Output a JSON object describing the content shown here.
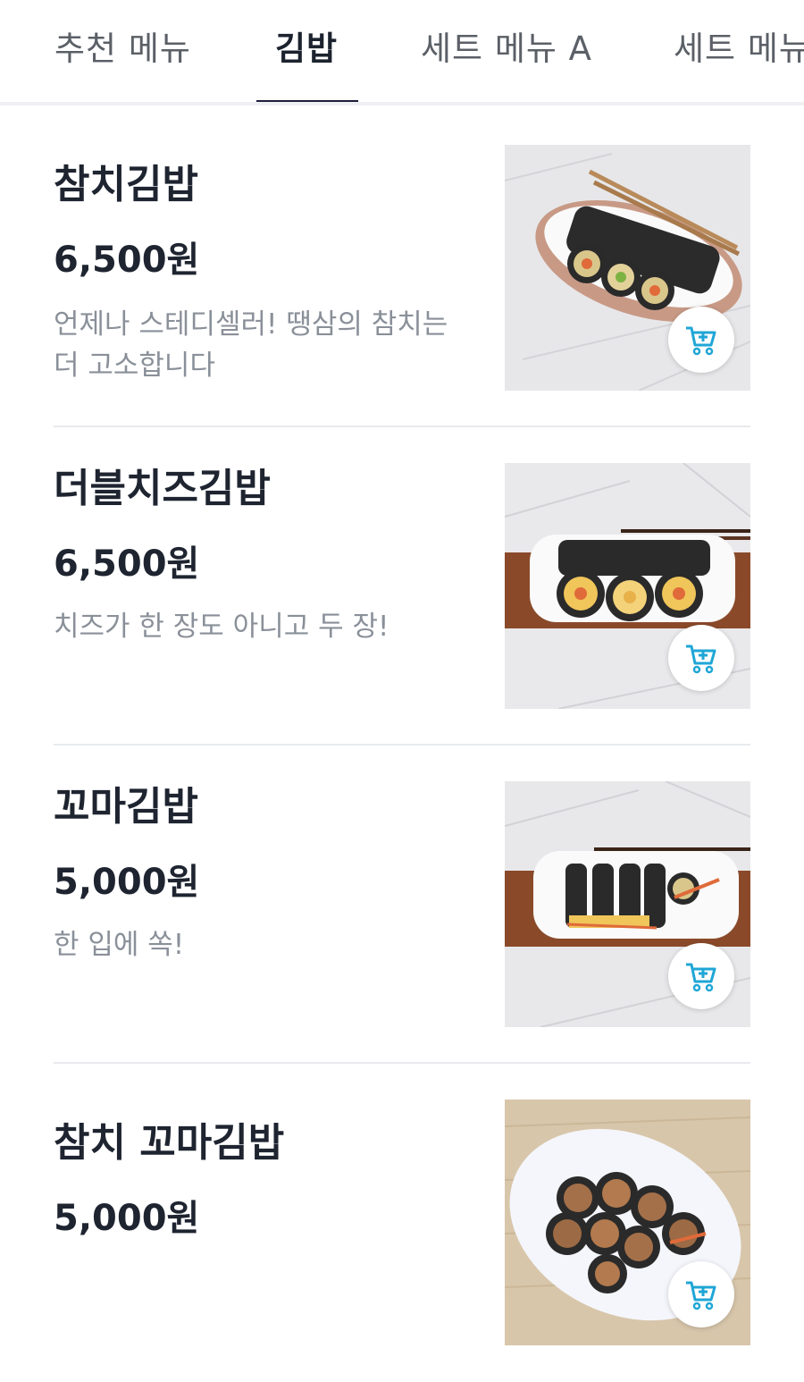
{
  "tabs": [
    {
      "label": "추천 메뉴",
      "active": false
    },
    {
      "label": "김밥",
      "active": true
    },
    {
      "label": "세트 메뉴 A",
      "active": false
    },
    {
      "label": "세트 메뉴",
      "active": false
    }
  ],
  "menu_items": [
    {
      "name": "참치김밥",
      "price": "6,500원",
      "description": "언제나 스테디셀러! 땡삼의 참치는 더 고소합니다",
      "photo": "tuna-kimbap-photo"
    },
    {
      "name": "더블치즈김밥",
      "price": "6,500원",
      "description": "치즈가 한 장도 아니고 두 장!",
      "photo": "double-cheese-kimbap-photo"
    },
    {
      "name": "꼬마김밥",
      "price": "5,000원",
      "description": "한 입에 쏙!",
      "photo": "mini-kimbap-photo"
    },
    {
      "name": "참치 꼬마김밥",
      "price": "5,000원",
      "description": "",
      "photo": "tuna-mini-kimbap-photo"
    }
  ],
  "icons": {
    "cart_add": "cart-add-icon"
  },
  "colors": {
    "accent": "#1c1d3a",
    "cart_icon": "#1fa6d6",
    "text": "#1e2430",
    "muted": "#8a9099"
  }
}
